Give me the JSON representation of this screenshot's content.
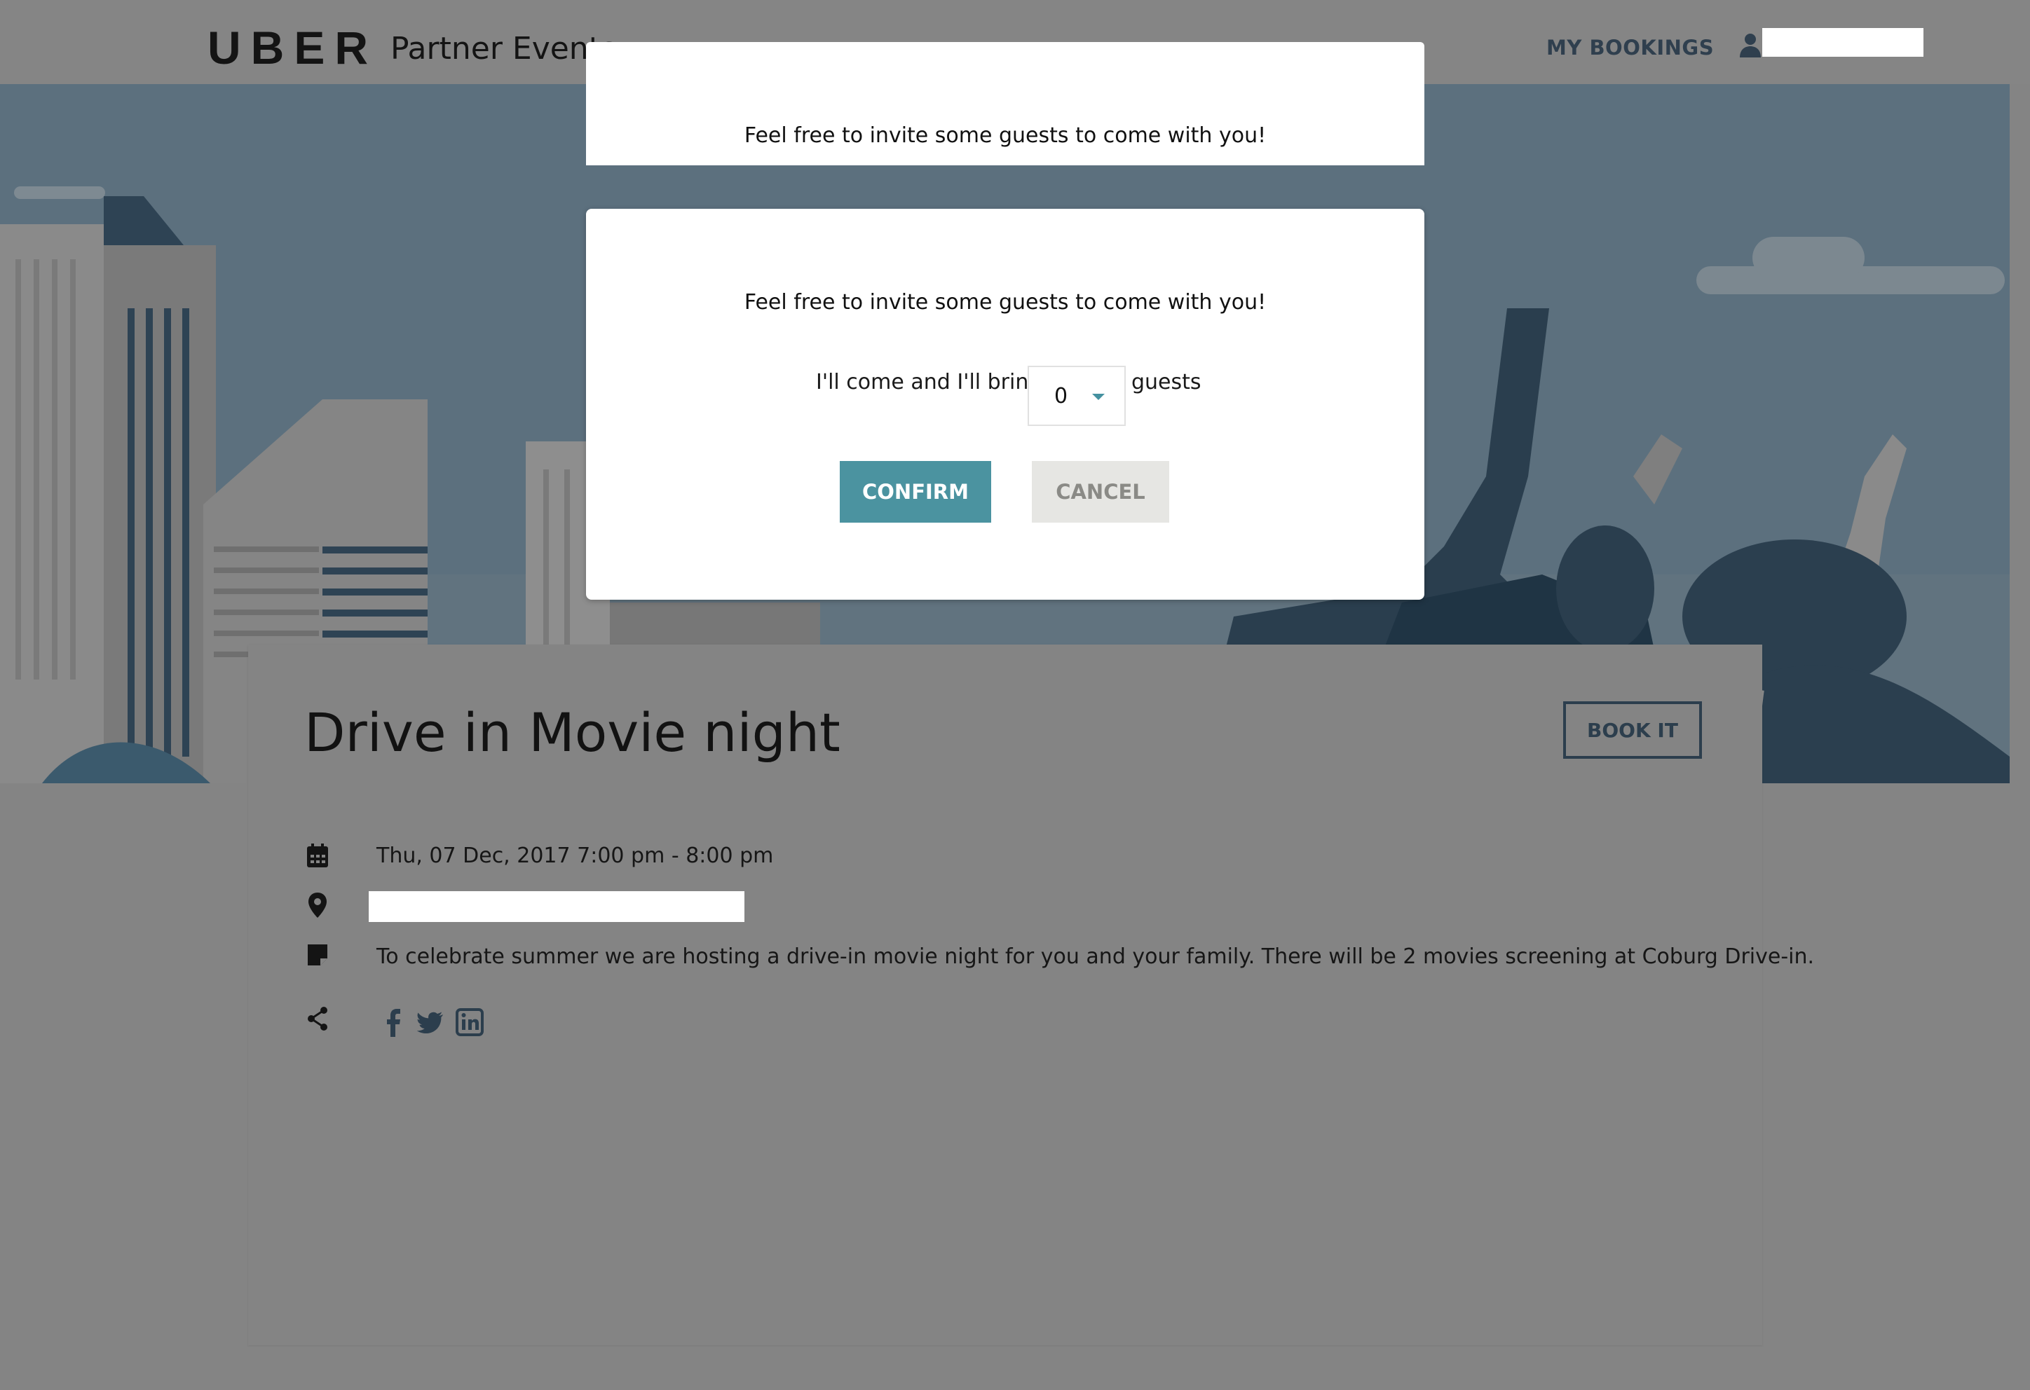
{
  "header": {
    "logo": "UBER",
    "subtitle": "Partner Events",
    "nav_bookings": "MY BOOKINGS",
    "user_icon": "user-icon"
  },
  "event": {
    "title": "Drive in Movie night",
    "book_button": "BOOK IT",
    "datetime": "Thu, 07 Dec, 2017 7:00 pm - 8:00 pm",
    "description": "To celebrate summer we are hosting a drive-in movie night for you and your family. There will be 2 movies screening at Coburg Drive-in.",
    "icons": {
      "date": "calendar-icon",
      "location": "location-pin-icon",
      "description": "note-icon",
      "share": "share-icon"
    },
    "social": [
      "facebook-icon",
      "twitter-icon",
      "linkedin-icon"
    ]
  },
  "modal": {
    "message": "Feel free to invite some guests to come with you!",
    "bring_prefix": "I'll come and I'll bring",
    "guests_value": "0",
    "bring_suffix": "guests",
    "confirm_label": "CONFIRM",
    "cancel_label": "CANCEL"
  },
  "colors": {
    "overlay_bg": "#848484",
    "confirm": "#4b93a0",
    "cancel": "#e6e6e3",
    "dark_text": "#2c3e4d"
  }
}
